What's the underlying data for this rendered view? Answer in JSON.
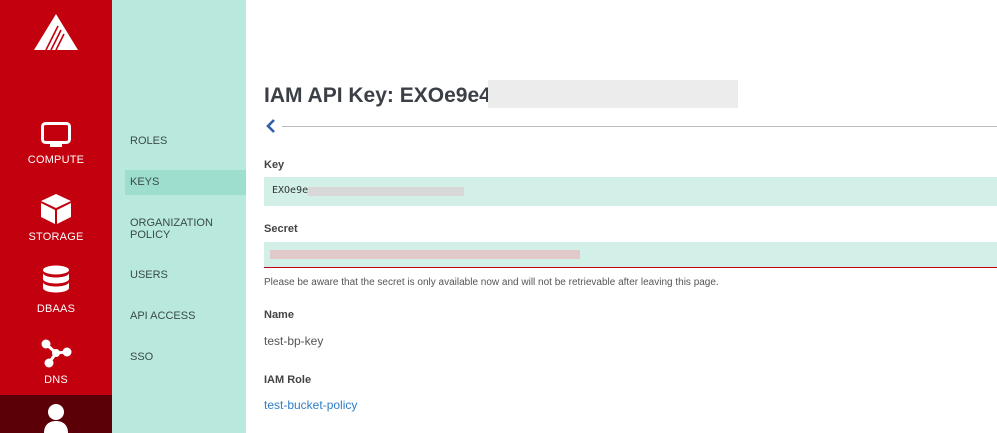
{
  "rail": {
    "items": [
      {
        "label": "COMPUTE",
        "icon": "monitor-icon"
      },
      {
        "label": "STORAGE",
        "icon": "cube-icon"
      },
      {
        "label": "DBAAS",
        "icon": "database-icon"
      },
      {
        "label": "DNS",
        "icon": "network-icon"
      }
    ],
    "active_icon": "user-icon",
    "brand_color": "#c2000e"
  },
  "subnav": {
    "items": [
      {
        "label": "ROLES"
      },
      {
        "label": "KEYS"
      },
      {
        "label": "ORGANIZATION POLICY"
      },
      {
        "label": "USERS"
      },
      {
        "label": "API ACCESS"
      },
      {
        "label": "SSO"
      }
    ],
    "active": "KEYS",
    "bg_color": "#b9e8dc"
  },
  "main": {
    "title": "IAM API Key: EXOe9e4",
    "key": {
      "label": "Key",
      "value": "EXOe9e"
    },
    "secret": {
      "label": "Secret"
    },
    "note": "Please be aware that the secret is only available now and will not be retrievable after leaving this page.",
    "name": {
      "label": "Name",
      "value": "test-bp-key"
    },
    "iam_role": {
      "label": "IAM Role",
      "value": "test-bucket-policy"
    }
  }
}
